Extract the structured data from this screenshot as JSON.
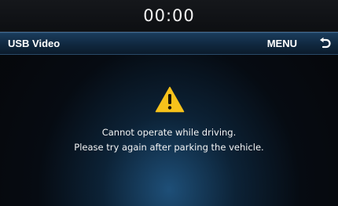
{
  "status_bar": {
    "clock": "00:00"
  },
  "title_bar": {
    "title": "USB Video",
    "menu_label": "MENU",
    "back_icon": "back-arrow-icon"
  },
  "warning": {
    "icon": "warning-triangle-icon",
    "line1": "Cannot operate while driving.",
    "line2": "Please try again after parking the vehicle."
  },
  "colors": {
    "warning_yellow": "#f7c21b",
    "title_bar_blue": "#143350",
    "background": "#050608"
  }
}
